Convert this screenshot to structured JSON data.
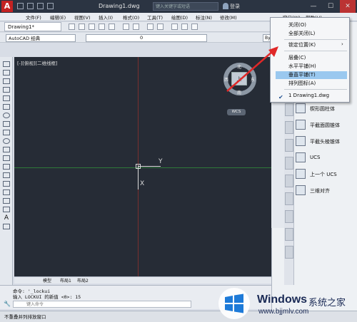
{
  "window": {
    "doc_title": "Drawing1.dwg",
    "search_placeholder": "键入关键字或短语",
    "login": "登录",
    "controls": [
      "—",
      "☐",
      "✕"
    ]
  },
  "menubar": [
    "文件(F)",
    "编辑(E)",
    "视图(V)",
    "插入(I)",
    "格式(O)",
    "工具(T)",
    "绘图(D)",
    "标注(N)",
    "修改(M)",
    "窗口(W)",
    "帮助(H)"
  ],
  "doc_tab": "Drawing1*",
  "toolbar": {
    "workspace": "AutoCAD 经典",
    "layer_value": "0",
    "bylayer": "ByL"
  },
  "viewport": {
    "label": "[-][俯视][二维线框]",
    "viewcube_face": "上",
    "viewcube_n": "北",
    "viewcube_s": "南",
    "viewcube_w": "西",
    "viewcube_e": "东",
    "wcs": "WCS",
    "axis_y": "Y",
    "axis_x": "X"
  },
  "layout_tabs": [
    "模型",
    "布局1",
    "布局2"
  ],
  "command": {
    "line1": "命令: '_lockui",
    "line2": "输入 LOCKUI 的新值 <0>: 15",
    "prompt": "键入命令"
  },
  "status": "不重叠并列排放窗口",
  "window_menu": {
    "items": [
      "关闭(O)",
      "全部关闭(L)",
      "锁定位置(K)",
      "层叠(C)",
      "水平平铺(H)",
      "垂直平铺(T)",
      "排列图标(A)",
      "1 Drawing1.dwg"
    ],
    "highlighted_index": 5,
    "checked_index": 7
  },
  "tool_palette": [
    "楔形圆柱体",
    "平截面圆锥体",
    "平截头棱锥体",
    "UCS",
    "上一个 UCS",
    "三维对齐"
  ],
  "watermark": {
    "name": "Windows",
    "cn": "系统之家",
    "url": "www.bjjmlv.com"
  },
  "colors": {
    "canvas": "#262c36",
    "highlight": "#9ac8ef",
    "arrow": "#e02828",
    "logo_red": "#c32222"
  }
}
